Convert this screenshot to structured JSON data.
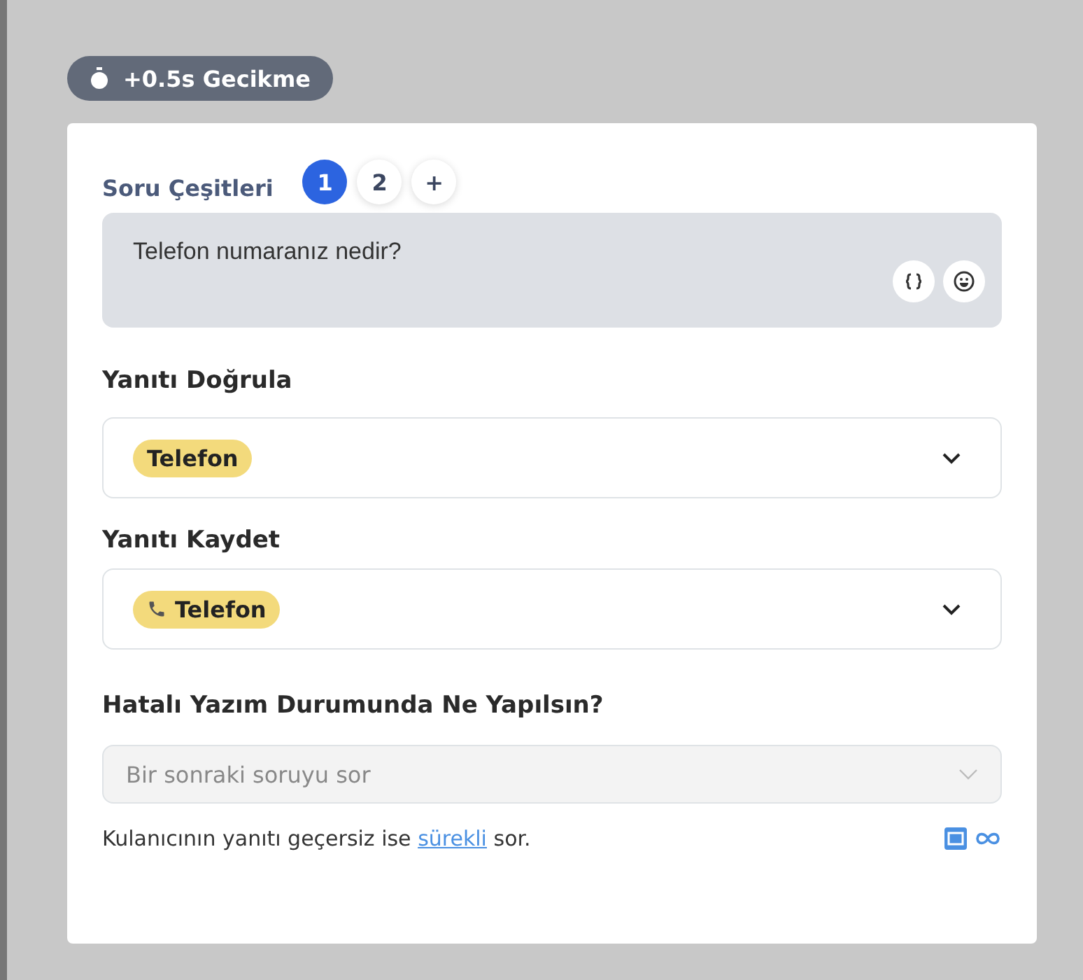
{
  "delay_badge": {
    "text": "+0.5s Gecikme"
  },
  "question_types": {
    "label": "Soru Çeşitleri",
    "tabs": [
      {
        "label": "1",
        "selected": true
      },
      {
        "label": "2",
        "selected": false
      }
    ],
    "add": "+"
  },
  "question": {
    "value": "Telefon numaranız nedir?"
  },
  "validate": {
    "label": "Yanıtı Doğrula",
    "tag": "Telefon",
    "tag_icon": false
  },
  "save": {
    "label": "Yanıtı Kaydet",
    "tag": "Telefon",
    "tag_icon": true
  },
  "on_error": {
    "label": "Hatalı Yazım Durumunda Ne Yapılsın?",
    "value": "Bir sonraki soruyu sor",
    "disabled": true
  },
  "hint": {
    "before": "Kulanıcının yanıtı geçersiz ise",
    "link": "sürekli",
    "after": "sor."
  }
}
